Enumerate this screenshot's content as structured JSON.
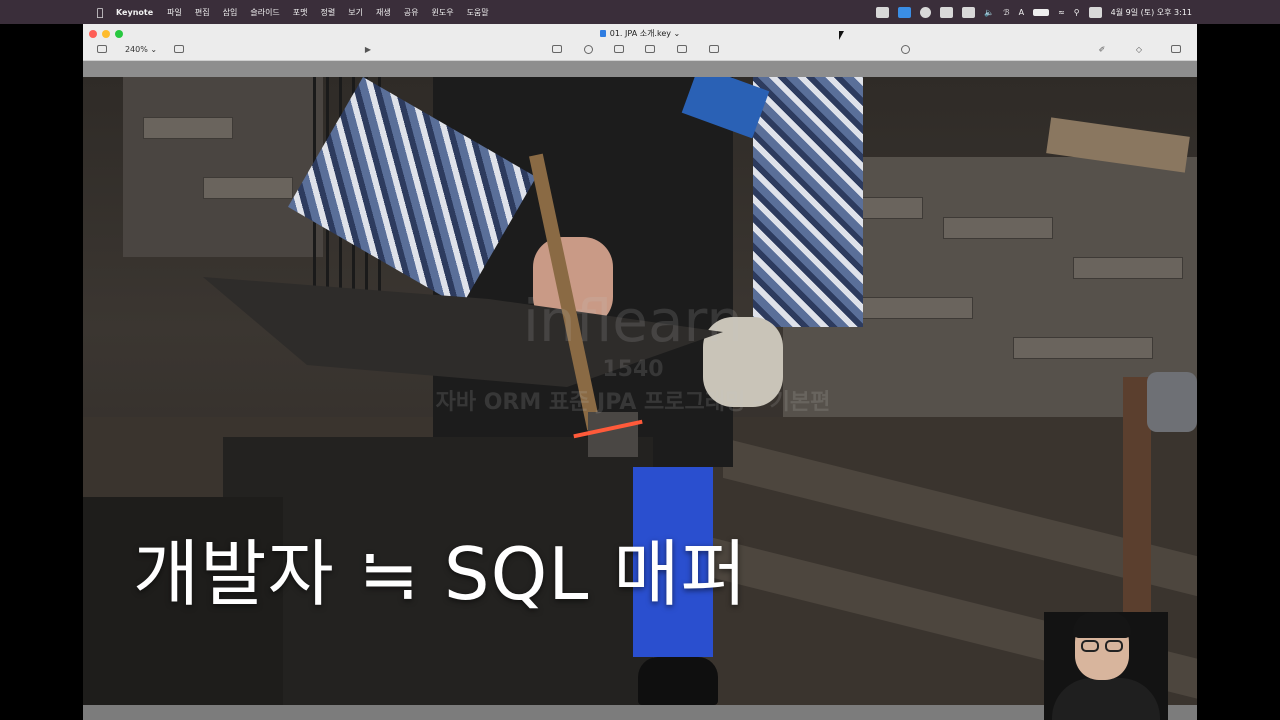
{
  "menubar": {
    "app_name": "Keynote",
    "menu_items": [
      "파일",
      "편집",
      "삽입",
      "슬라이드",
      "포맷",
      "정렬",
      "보기",
      "재생",
      "공유",
      "윈도우",
      "도움말"
    ],
    "clock": "4월 9일 (토) 오후 3:11",
    "input_indicator": "A"
  },
  "window": {
    "document_title": "01. JPA 소개.key",
    "zoom_level": "240%"
  },
  "slide": {
    "title": "개발자 ≒ SQL 매퍼",
    "watermark_logo": "inflearn",
    "watermark_line1": "1540",
    "watermark_line2": "자바 ORM 표준 JPA 프로그래밍 - 기본편"
  }
}
